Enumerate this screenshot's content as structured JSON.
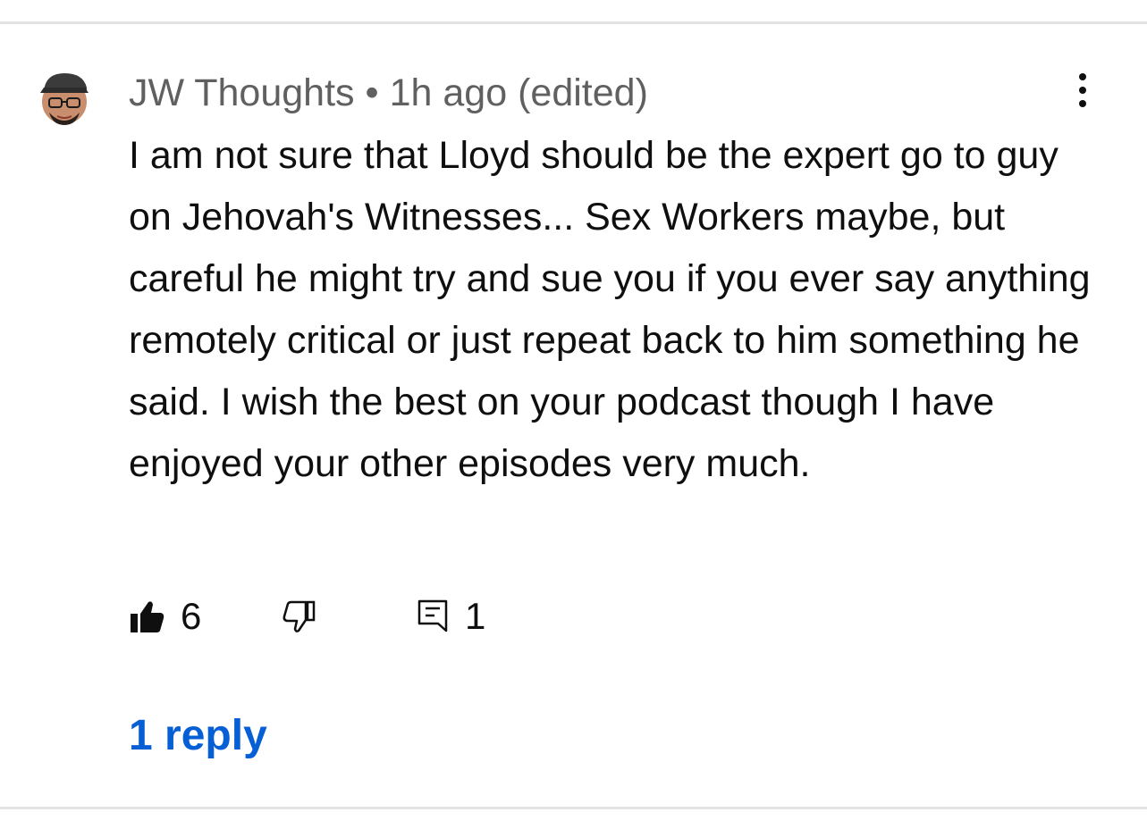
{
  "comment": {
    "author": "JW Thoughts",
    "separator": "•",
    "time": "1h ago",
    "edited": "(edited)",
    "text": "I am not sure that Lloyd should be the expert go to guy on Jehovah's Witnesses... Sex Workers maybe, but careful he might try and sue you if you ever say anything remotely critical or just repeat back to him something he said. I wish the best on your podcast though I have enjoyed your other episodes very much.",
    "likes": "6",
    "reply_count": "1",
    "replies_link": "1 reply"
  },
  "icons": {
    "avatar": "avatar-icon",
    "menu": "more-vert-icon",
    "like": "thumbs-up-filled-icon",
    "dislike": "thumbs-down-outline-icon",
    "reply": "comment-icon"
  },
  "colors": {
    "link": "#065fd4",
    "meta": "#606060",
    "text": "#0f0f0f",
    "divider": "#e3e3e3"
  }
}
